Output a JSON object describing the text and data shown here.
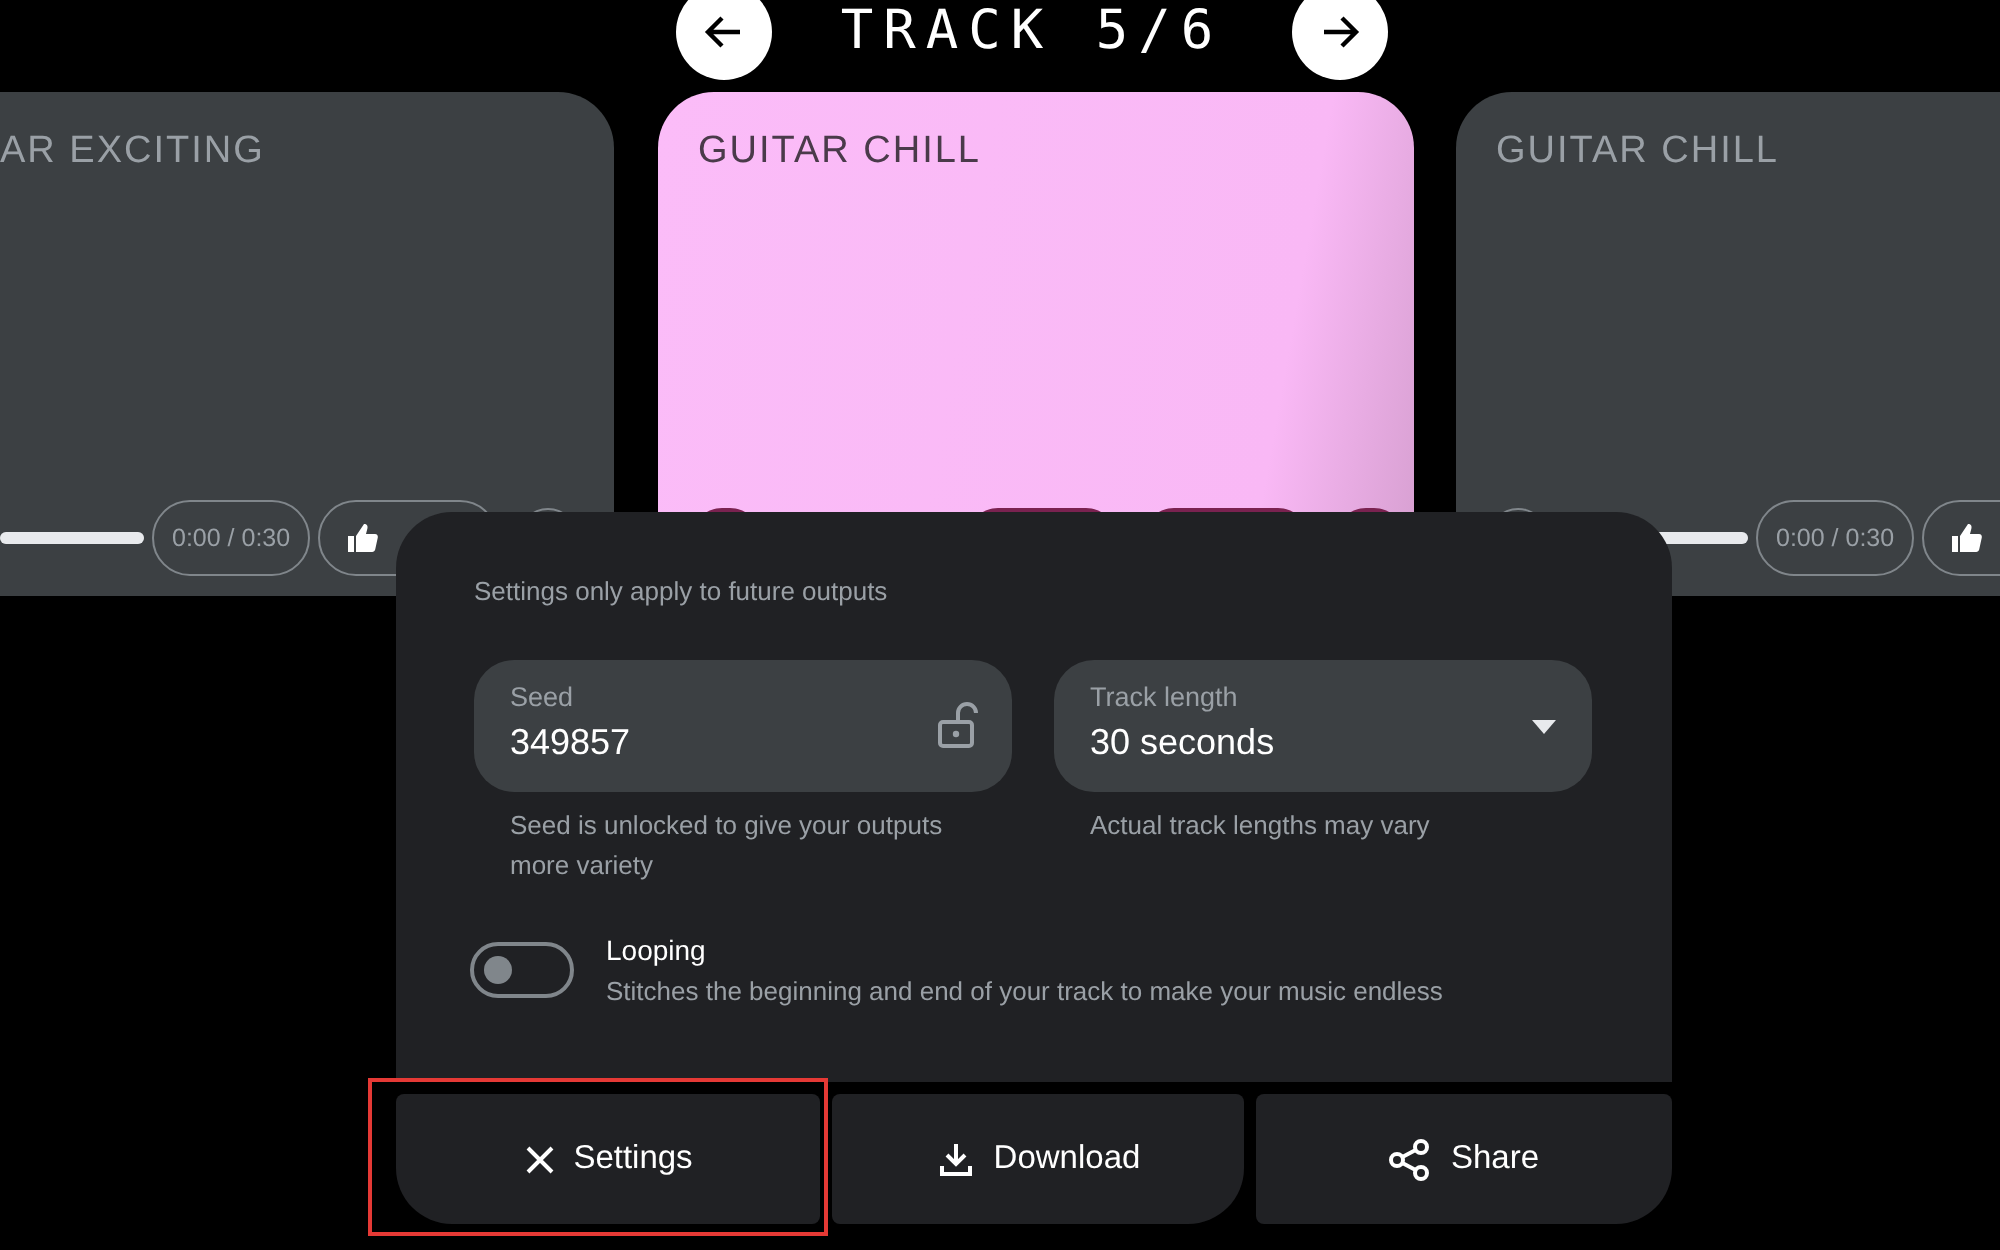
{
  "header": {
    "title": "TRACK 5/6"
  },
  "cards": [
    {
      "kind": "left",
      "title": "AR EXCITING",
      "time": "0:00 / 0:30",
      "level": 1
    },
    {
      "kind": "center",
      "title": "GUITAR CHILL"
    },
    {
      "kind": "right",
      "title": "GUITAR CHILL",
      "time": "0:00 / 0:30",
      "level": 1
    }
  ],
  "settings": {
    "note": "Settings only apply to future outputs",
    "seed": {
      "label": "Seed",
      "value": "349857",
      "locked": false,
      "helper": "Seed is unlocked to give your outputs more variety"
    },
    "track_length": {
      "label": "Track length",
      "value": "30 seconds",
      "helper": "Actual track lengths may vary"
    },
    "looping": {
      "label": "Looping",
      "description": "Stitches the beginning and end of your track to make your music endless",
      "on": false
    }
  },
  "actions": [
    {
      "kind": "close",
      "label": "Settings",
      "highlighted": true
    },
    {
      "kind": "download",
      "label": "Download",
      "highlighted": false
    },
    {
      "kind": "share",
      "label": "Share",
      "highlighted": false
    }
  ]
}
